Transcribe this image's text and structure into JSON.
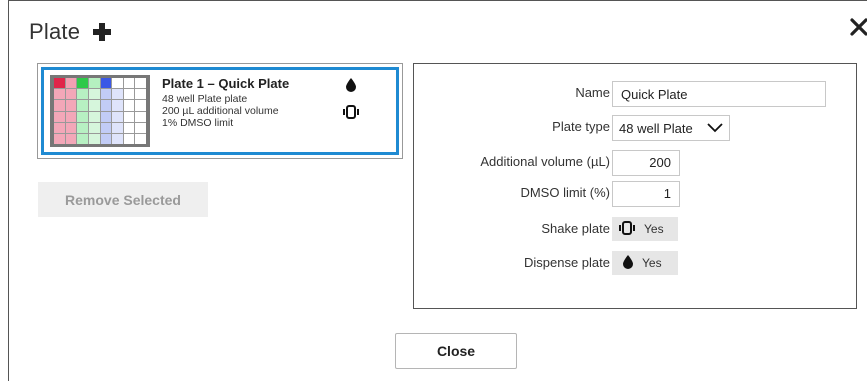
{
  "dialog": {
    "title": "Plate",
    "add_icon": "plus-icon",
    "close_icon": "close-icon"
  },
  "plate_card": {
    "name": "Plate 1 – Quick Plate",
    "lines": [
      "48 well Plate plate",
      "200 µL additional volume",
      "1% DMSO limit"
    ],
    "icons": [
      "drop-icon",
      "shake-icon"
    ],
    "colors": {
      "selected_border": "#1f8ad2",
      "red": "#e0254a",
      "green": "#2ec94a",
      "blue": "#3b58e6"
    }
  },
  "remove_button": {
    "label": "Remove Selected"
  },
  "properties": {
    "name": {
      "label": "Name",
      "value": "Quick Plate"
    },
    "plate_type": {
      "label": "Plate type",
      "value": "48 well Plate"
    },
    "additional_volume": {
      "label": "Additional volume (µL)",
      "value": "200"
    },
    "dmso_limit": {
      "label": "DMSO limit (%)",
      "value": "1"
    },
    "shake_plate": {
      "label": "Shake plate",
      "value": "Yes",
      "icon": "shake-icon"
    },
    "dispense_plate": {
      "label": "Dispense plate",
      "value": "Yes",
      "icon": "drop-icon"
    }
  },
  "footer": {
    "close_label": "Close"
  }
}
